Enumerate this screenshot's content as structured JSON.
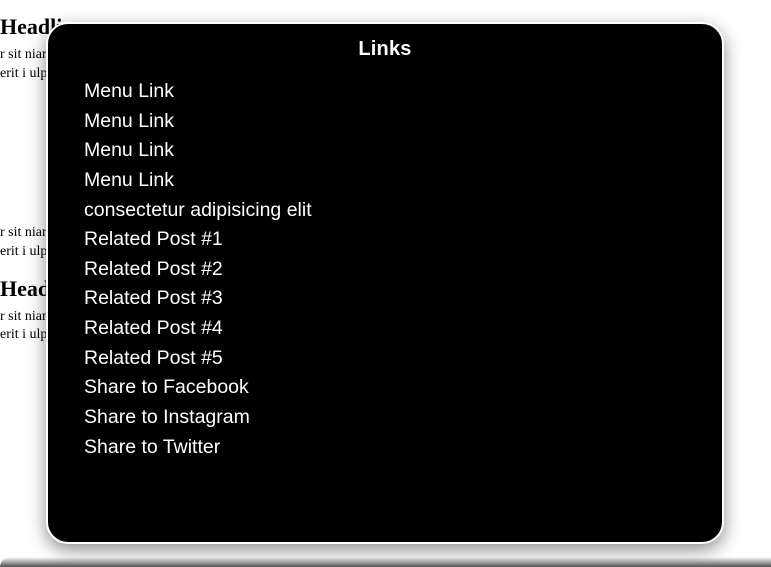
{
  "background": {
    "heading1": "Headline",
    "para_fragment": "r sit\nniam\nerit i\nulpa",
    "heading2": "Headline"
  },
  "modal": {
    "title": "Links",
    "links": [
      "Menu Link",
      "Menu Link",
      "Menu Link",
      "Menu Link",
      "consectetur adipisicing elit",
      "Related Post #1",
      "Related Post #2",
      "Related Post #3",
      "Related Post #4",
      "Related Post #5",
      "Share to Facebook",
      "Share to Instagram",
      "Share to Twitter"
    ]
  }
}
